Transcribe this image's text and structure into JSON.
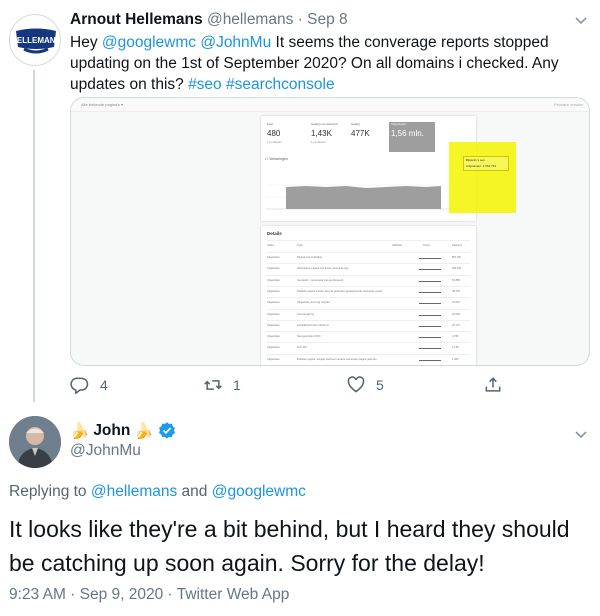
{
  "original_tweet": {
    "author_name": "Arnout Hellemans",
    "author_handle": "@hellemans",
    "separator": "·",
    "date": "Sep 8",
    "avatar_brand": "HELLEMANS",
    "text_parts": [
      {
        "text": "Hey ",
        "type": "plain"
      },
      {
        "text": "@googlewmc",
        "type": "link"
      },
      {
        "text": " ",
        "type": "plain"
      },
      {
        "text": "@JohnMu",
        "type": "link"
      },
      {
        "text": " It seems the converage reports stopped updating on the 1st of September 2020? On all domains i checked. Any updates on this? ",
        "type": "plain"
      },
      {
        "text": "#seo",
        "type": "link"
      },
      {
        "text": " ",
        "type": "plain"
      },
      {
        "text": "#searchconsole",
        "type": "link"
      }
    ],
    "media": {
      "stats": [
        {
          "label": "Fout",
          "value": "480",
          "sub": "1 probleem"
        },
        {
          "label": "Geldig met waarsch.",
          "value": "1,43K",
          "sub": "1 probleem"
        },
        {
          "label": "Geldig",
          "value": "477K",
          "sub": ""
        },
        {
          "label": "Uitgesloten",
          "value": "1,56 mln.",
          "sub": ""
        }
      ],
      "chart_checkbox": "Vertoningen",
      "legend_title": "Bijwerkt 1 sep",
      "legend_value": "Uitgesloten: 1.564.734",
      "details_title": "Details",
      "details_headers": [
        "Status",
        "Type",
        "Validatie",
        "Trend",
        "Pagina's"
      ],
      "details_rows": [
        {
          "status": "Uitgesloten",
          "type": "Pagina met omleiding",
          "pages": "867.297"
        },
        {
          "status": "Uitgesloten",
          "type": "Alternatieve pagina met juiste canonieke tag",
          "pages": "364.633"
        },
        {
          "status": "Uitgesloten",
          "type": "Gecrawld - momenteel niet geïndexeerd",
          "pages": "52.885"
        },
        {
          "status": "Uitgesloten",
          "type": "Dubbele pagina zonder door de gebruiker geselecteerde canonieke versie",
          "pages": "38.278"
        },
        {
          "status": "Uitgesloten",
          "type": "Uitgesloten door tag noindex",
          "pages": "22.697"
        },
        {
          "status": "Uitgesloten",
          "type": "Doorverwijzing",
          "pages": "20.090"
        },
        {
          "status": "Uitgesloten",
          "type": "Geblokkeerd door robots.txt",
          "pages": "20.747"
        },
        {
          "status": "Uitgesloten",
          "type": "Niet gevonden (404)",
          "pages": "2.782"
        },
        {
          "status": "Uitgesloten",
          "type": "Soft 404",
          "pages": "1.138"
        },
        {
          "status": "Uitgesloten",
          "type": "Dubbele pagina, Google heeft een andere canonieke pagina gekozen",
          "pages": "1.060"
        }
      ]
    },
    "actions": {
      "replies": "4",
      "retweets": "1",
      "likes": "5"
    }
  },
  "reply_tweet": {
    "name_prefix_emoji": "🍌",
    "author_name": "John",
    "name_suffix_emoji": "🍌",
    "author_handle": "@JohnMu",
    "replying_label": "Replying to ",
    "replying_to_1": "@hellemans",
    "replying_and": " and ",
    "replying_to_2": "@googlewmc",
    "text": "It looks like they're a bit behind, but I heard they should be catching up soon again. Sorry for the delay!",
    "timestamp": "9:23 AM · Sep 9, 2020 · Twitter Web App"
  },
  "colors": {
    "link": "#1b95e0",
    "muted": "#657786",
    "verified": "#1d9bf0",
    "highlight": "#f5f500"
  }
}
